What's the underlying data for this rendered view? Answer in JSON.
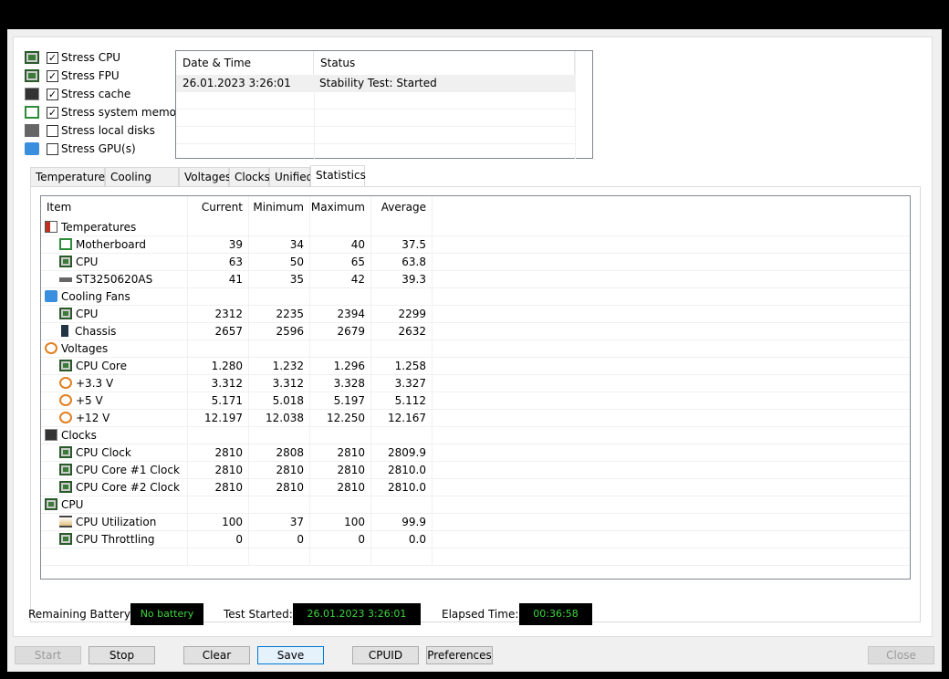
{
  "options": [
    {
      "label": "Stress CPU",
      "checked": true,
      "icon": "cpu-icon"
    },
    {
      "label": "Stress FPU",
      "checked": true,
      "icon": "fpu-icon"
    },
    {
      "label": "Stress cache",
      "checked": true,
      "icon": "cache-icon"
    },
    {
      "label": "Stress system memory",
      "checked": true,
      "icon": "memory-icon"
    },
    {
      "label": "Stress local disks",
      "checked": false,
      "icon": "disk-icon"
    },
    {
      "label": "Stress GPU(s)",
      "checked": false,
      "icon": "gpu-icon"
    }
  ],
  "log": {
    "headers": [
      "Date & Time",
      "Status"
    ],
    "rows": [
      [
        "26.01.2023 3:26:01",
        "Stability Test: Started"
      ]
    ]
  },
  "tabs": [
    "Temperatures",
    "Cooling Fans",
    "Voltages",
    "Clocks",
    "Unified",
    "Statistics"
  ],
  "active_tab": "Statistics",
  "table": {
    "headers": [
      "Item",
      "Current",
      "Minimum",
      "Maximum",
      "Average"
    ],
    "rows": [
      {
        "group": true,
        "icon": "therm",
        "item": "Temperatures"
      },
      {
        "icon": "mb",
        "item": "Motherboard",
        "cur": "39",
        "min": "34",
        "max": "40",
        "avg": "37.5"
      },
      {
        "icon": "chip",
        "item": "CPU",
        "cur": "63",
        "min": "50",
        "max": "65",
        "avg": "63.8"
      },
      {
        "icon": "hdd",
        "item": "ST3250620AS",
        "cur": "41",
        "min": "35",
        "max": "42",
        "avg": "39.3"
      },
      {
        "group": true,
        "icon": "fan",
        "item": "Cooling Fans"
      },
      {
        "icon": "chip",
        "item": "CPU",
        "cur": "2312",
        "min": "2235",
        "max": "2394",
        "avg": "2299"
      },
      {
        "icon": "case",
        "item": "Chassis",
        "cur": "2657",
        "min": "2596",
        "max": "2679",
        "avg": "2632"
      },
      {
        "group": true,
        "icon": "volt",
        "item": "Voltages"
      },
      {
        "icon": "chip",
        "item": "CPU Core",
        "cur": "1.280",
        "min": "1.232",
        "max": "1.296",
        "avg": "1.258"
      },
      {
        "icon": "volt",
        "item": "+3.3 V",
        "cur": "3.312",
        "min": "3.312",
        "max": "3.328",
        "avg": "3.327"
      },
      {
        "icon": "volt",
        "item": "+5 V",
        "cur": "5.171",
        "min": "5.018",
        "max": "5.197",
        "avg": "5.112"
      },
      {
        "icon": "volt",
        "item": "+12 V",
        "cur": "12.197",
        "min": "12.038",
        "max": "12.250",
        "avg": "12.167"
      },
      {
        "group": true,
        "icon": "cache",
        "item": "Clocks"
      },
      {
        "icon": "chip",
        "item": "CPU Clock",
        "cur": "2810",
        "min": "2808",
        "max": "2810",
        "avg": "2809.9"
      },
      {
        "icon": "chip",
        "item": "CPU Core #1 Clock",
        "cur": "2810",
        "min": "2810",
        "max": "2810",
        "avg": "2810.0"
      },
      {
        "icon": "chip",
        "item": "CPU Core #2 Clock",
        "cur": "2810",
        "min": "2810",
        "max": "2810",
        "avg": "2810.0"
      },
      {
        "group": true,
        "icon": "chip",
        "item": "CPU"
      },
      {
        "icon": "hour",
        "item": "CPU Utilization",
        "cur": "100",
        "min": "37",
        "max": "100",
        "avg": "99.9"
      },
      {
        "icon": "chip",
        "item": "CPU Throttling",
        "cur": "0",
        "min": "0",
        "max": "0",
        "avg": "0.0"
      }
    ]
  },
  "status": {
    "battery_label": "Remaining Battery:",
    "battery": "No battery",
    "started_label": "Test Started:",
    "started": "26.01.2023 3:26:01",
    "elapsed_label": "Elapsed Time:",
    "elapsed": "00:36:58"
  },
  "buttons": {
    "start": "Start",
    "stop": "Stop",
    "clear": "Clear",
    "save": "Save",
    "cpuid": "CPUID",
    "preferences": "Preferences",
    "close": "Close"
  }
}
